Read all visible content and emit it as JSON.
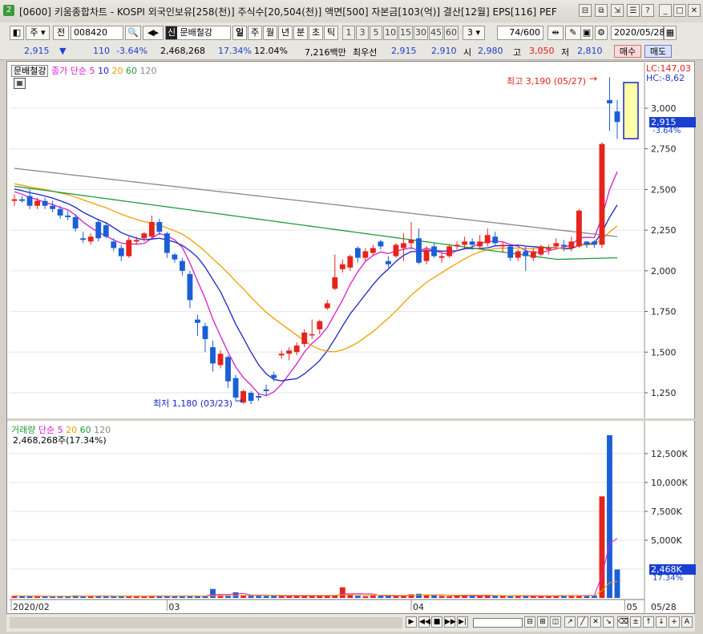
{
  "window": {
    "app_badge": "2",
    "title": "[0600] 키움종합차트 - KOSPI 외국인보유[258(천)] 주식수[20,504(천)] 액면[500] 자본금[103(억)] 결산[12월] EPS[116] PEF"
  },
  "toolbar": {
    "market_type": "주",
    "prev_label": "전",
    "stock_code": "008420",
    "badge": "신",
    "stock_name": "문배철강",
    "periods": [
      "일",
      "주",
      "월",
      "년",
      "분",
      "초",
      "틱"
    ],
    "active_period": "일",
    "intervals": [
      "1",
      "3",
      "5",
      "10",
      "15",
      "30",
      "45",
      "60"
    ],
    "interval_value": "3",
    "count": "74",
    "count_total": "/600",
    "date": "2020/05/28"
  },
  "quote": {
    "price": "2,915",
    "arrow": "▼",
    "change": "110",
    "change_pct": "-3.64%",
    "volume": "2,468,268",
    "volume_pct": "17.34%",
    "turnover": "12.04%",
    "trade_amount": "7,216백만",
    "best_bid_label": "최우선",
    "best_ask": "2,915",
    "best_bid": "2,910",
    "open_label": "시",
    "open": "2,980",
    "high_label": "고",
    "high": "3,050",
    "low_label": "저",
    "low": "2,810",
    "buy_label": "매수",
    "sell_label": "매도"
  },
  "price_panel": {
    "tag": "문배철강",
    "legend_prefix": "종가 단순",
    "ma_labels": [
      "5",
      "10",
      "20",
      "60",
      "120"
    ],
    "ma_colors": [
      "#d81bd0",
      "#1a25c4",
      "#f0a000",
      "#1f9c3b",
      "#888888"
    ],
    "lc": "LC:147,03",
    "hc": "HC:-8,62",
    "current_price": "2,915",
    "current_change": "-3.64%",
    "high_annotation": "최고 3,190 (05/27)",
    "low_annotation": "최저 1,180 (03/23)"
  },
  "volume_panel": {
    "legend_label": "거래량",
    "legend_prefix": "단순",
    "ma_labels": [
      "5",
      "20",
      "60",
      "120"
    ],
    "current_volume_text": "2,468,268주(17.34%)",
    "current_value": "2,468K",
    "current_pct": "17.34%"
  },
  "chart_data": {
    "type": "candlestick",
    "price_axis_ticks": [
      "3,000",
      "2,750",
      "2,500",
      "2,250",
      "2,000",
      "1,750",
      "1,500",
      "1,250"
    ],
    "volume_axis_ticks": [
      "12,500K",
      "10,000K",
      "7,500K",
      "5,000K"
    ],
    "date_labels": [
      "2020/02",
      "03",
      "04",
      "05"
    ],
    "last_date_label": "05/28",
    "ohlc": [
      [
        2430,
        2470,
        2400,
        2440
      ],
      [
        2440,
        2460,
        2420,
        2430
      ],
      [
        2460,
        2500,
        2380,
        2400
      ],
      [
        2400,
        2450,
        2380,
        2430
      ],
      [
        2430,
        2450,
        2380,
        2400
      ],
      [
        2400,
        2430,
        2360,
        2380
      ],
      [
        2380,
        2400,
        2320,
        2340
      ],
      [
        2340,
        2370,
        2310,
        2330
      ],
      [
        2330,
        2350,
        2240,
        2260
      ],
      [
        2200,
        2240,
        2170,
        2190
      ],
      [
        2180,
        2230,
        2160,
        2210
      ],
      [
        2300,
        2320,
        2180,
        2200
      ],
      [
        2280,
        2300,
        2200,
        2210
      ],
      [
        2180,
        2200,
        2120,
        2140
      ],
      [
        2140,
        2160,
        2060,
        2090
      ],
      [
        2090,
        2210,
        2080,
        2190
      ],
      [
        2180,
        2210,
        2160,
        2190
      ],
      [
        2200,
        2240,
        2180,
        2230
      ],
      [
        2210,
        2340,
        2200,
        2300
      ],
      [
        2300,
        2320,
        2220,
        2240
      ],
      [
        2230,
        2240,
        2080,
        2110
      ],
      [
        2100,
        2110,
        2050,
        2070
      ],
      [
        2060,
        2080,
        1970,
        2000
      ],
      [
        1980,
        2000,
        1770,
        1820
      ],
      [
        1700,
        1730,
        1600,
        1680
      ],
      [
        1660,
        1680,
        1500,
        1580
      ],
      [
        1530,
        1570,
        1380,
        1430
      ],
      [
        1420,
        1510,
        1400,
        1490
      ],
      [
        1470,
        1480,
        1280,
        1320
      ],
      [
        1340,
        1360,
        1200,
        1220
      ],
      [
        1190,
        1270,
        1180,
        1260
      ],
      [
        1250,
        1260,
        1180,
        1200
      ],
      [
        1230,
        1250,
        1200,
        1220
      ],
      [
        1270,
        1300,
        1230,
        1260
      ],
      [
        1360,
        1380,
        1320,
        1340
      ],
      [
        1480,
        1510,
        1460,
        1490
      ],
      [
        1490,
        1530,
        1450,
        1510
      ],
      [
        1500,
        1560,
        1480,
        1540
      ],
      [
        1550,
        1640,
        1530,
        1620
      ],
      [
        1610,
        1700,
        1580,
        1610
      ],
      [
        1640,
        1700,
        1610,
        1690
      ],
      [
        1770,
        1820,
        1760,
        1800
      ],
      [
        1890,
        2100,
        1880,
        1960
      ],
      [
        2010,
        2070,
        1990,
        2040
      ],
      [
        2020,
        2100,
        2000,
        2090
      ],
      [
        2140,
        2150,
        2050,
        2080
      ],
      [
        2080,
        2140,
        2060,
        2120
      ],
      [
        2110,
        2160,
        2090,
        2140
      ],
      [
        2180,
        2190,
        2130,
        2150
      ],
      [
        2060,
        2090,
        2020,
        2040
      ],
      [
        2090,
        2170,
        2080,
        2160
      ],
      [
        2140,
        2230,
        2060,
        2170
      ],
      [
        2170,
        2300,
        2130,
        2190
      ],
      [
        2200,
        2260,
        2040,
        2050
      ],
      [
        2060,
        2150,
        2040,
        2130
      ],
      [
        2150,
        2170,
        2080,
        2090
      ],
      [
        2080,
        2110,
        2050,
        2090
      ],
      [
        2090,
        2160,
        2080,
        2150
      ],
      [
        2150,
        2180,
        2130,
        2160
      ],
      [
        2160,
        2210,
        2140,
        2180
      ],
      [
        2180,
        2200,
        2130,
        2160
      ],
      [
        2150,
        2220,
        2130,
        2180
      ],
      [
        2170,
        2260,
        2150,
        2220
      ],
      [
        2210,
        2240,
        2150,
        2170
      ],
      [
        2150,
        2180,
        2110,
        2160
      ],
      [
        2150,
        2160,
        2060,
        2080
      ],
      [
        2080,
        2130,
        2060,
        2120
      ],
      [
        2120,
        2150,
        2000,
        2090
      ],
      [
        2080,
        2140,
        2060,
        2120
      ],
      [
        2100,
        2160,
        2090,
        2150
      ],
      [
        2130,
        2160,
        2100,
        2140
      ],
      [
        2150,
        2200,
        2140,
        2170
      ],
      [
        2160,
        2190,
        2120,
        2150
      ],
      [
        2140,
        2210,
        2120,
        2180
      ]
    ],
    "volume_k": [
      180,
      160,
      150,
      150,
      140,
      130,
      150,
      120,
      220,
      170,
      150,
      190,
      140,
      130,
      150,
      180,
      160,
      130,
      200,
      190,
      150,
      170,
      140,
      210,
      160,
      150,
      780,
      220,
      170,
      490,
      230,
      200,
      180,
      170,
      190,
      160,
      140,
      230,
      190,
      180,
      170,
      200,
      230,
      920,
      290,
      190,
      150,
      200,
      170,
      220,
      190,
      170,
      320,
      360,
      250,
      220,
      180,
      160,
      170,
      210,
      190,
      180,
      240,
      220,
      180,
      150,
      170,
      140,
      160,
      150,
      170,
      200,
      230,
      240
    ],
    "extra_candles": [
      {
        "o": 2150,
        "h": 2380,
        "l": 2140,
        "c": 2370
      },
      {
        "o": 2180,
        "h": 2180,
        "l": 2140,
        "c": 2160
      },
      {
        "o": 2180,
        "h": 2190,
        "l": 2140,
        "c": 2160
      },
      {
        "o": 2160,
        "h": 2790,
        "l": 2140,
        "c": 2780
      },
      {
        "o": 3050,
        "h": 3190,
        "l": 2860,
        "c": 3030
      },
      {
        "o": 2980,
        "h": 3050,
        "l": 2810,
        "c": 2915
      }
    ],
    "extra_volume_k": [
      190,
      240,
      200,
      8800,
      14100,
      2468
    ]
  }
}
